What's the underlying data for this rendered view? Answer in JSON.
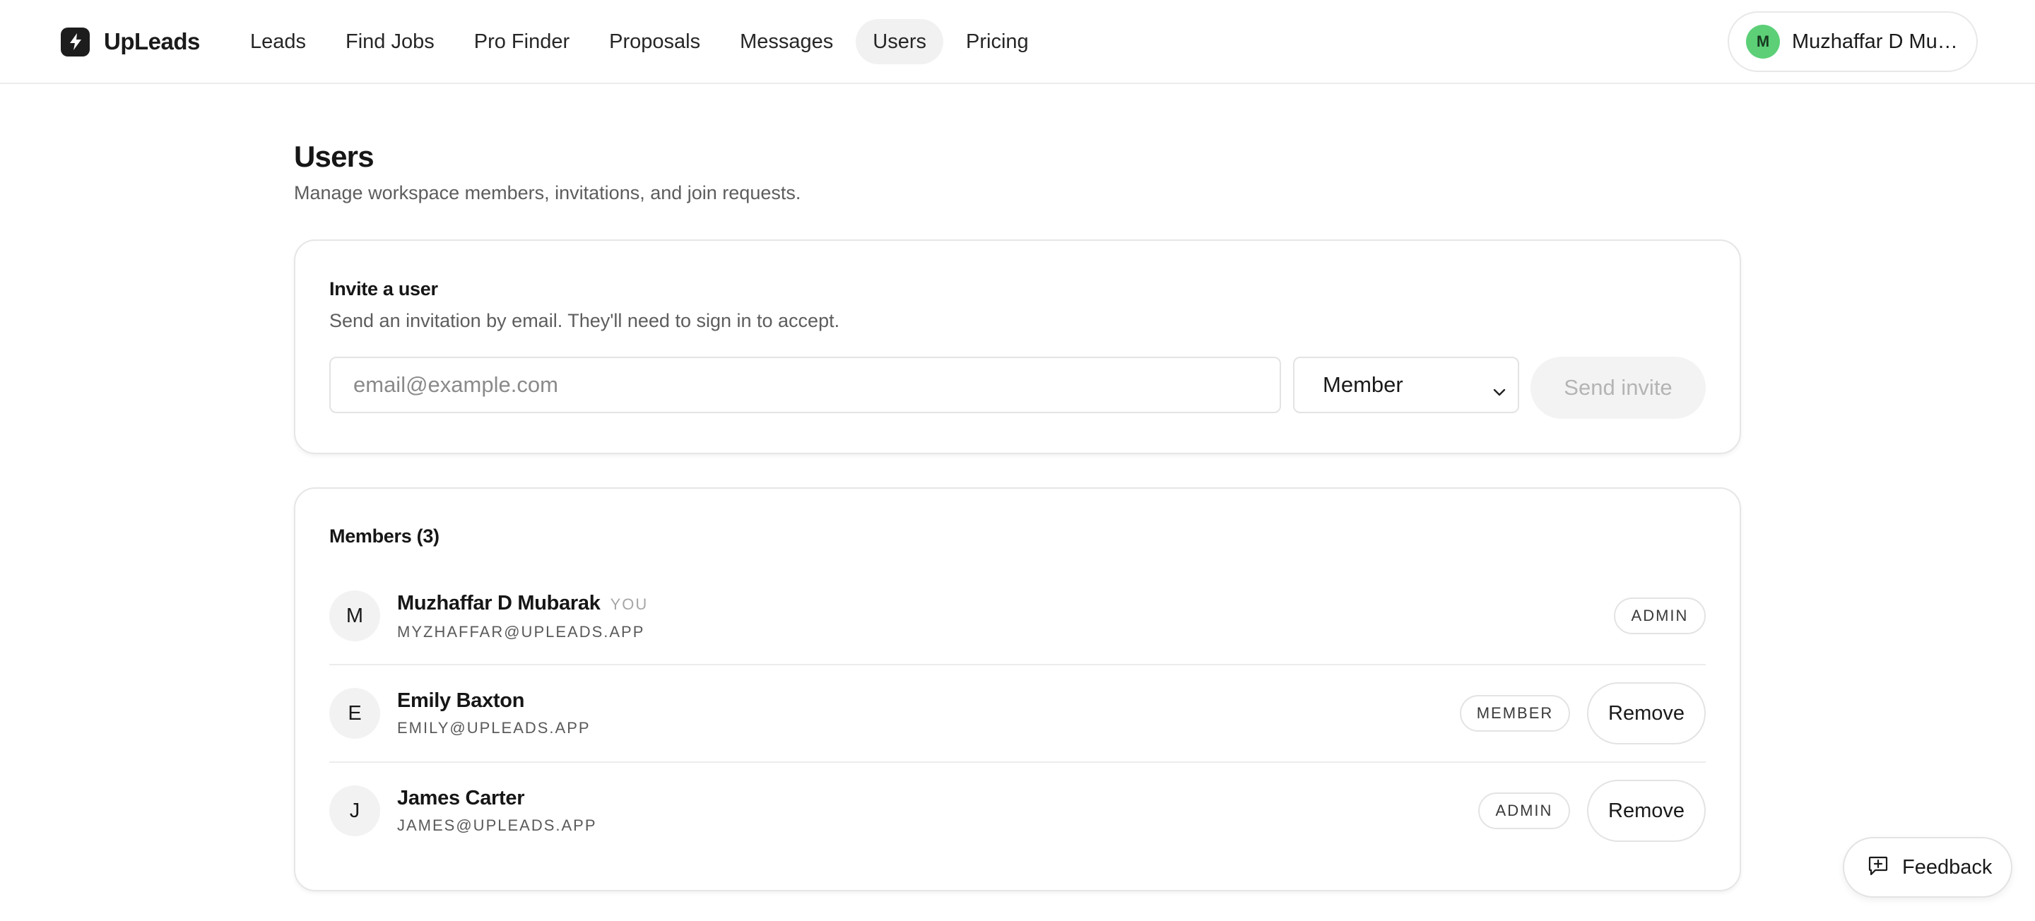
{
  "header": {
    "brand_name": "UpLeads",
    "brand_icon": "bolt-icon",
    "nav": [
      {
        "label": "Leads",
        "active": false
      },
      {
        "label": "Find Jobs",
        "active": false
      },
      {
        "label": "Pro Finder",
        "active": false
      },
      {
        "label": "Proposals",
        "active": false
      },
      {
        "label": "Messages",
        "active": false
      },
      {
        "label": "Users",
        "active": true
      },
      {
        "label": "Pricing",
        "active": false
      }
    ],
    "account": {
      "initial": "M",
      "name": "Muzhaffar D Mubarak",
      "avatar_color": "#5ccf77"
    }
  },
  "page": {
    "title": "Users",
    "subtitle": "Manage workspace members, invitations, and join requests."
  },
  "invite": {
    "title": "Invite a user",
    "description": "Send an invitation by email. They'll need to sign in to accept.",
    "email_placeholder": "email@example.com",
    "email_value": "",
    "role_selected": "Member",
    "send_label": "Send invite"
  },
  "members": {
    "title": "Members (3)",
    "rows": [
      {
        "initial": "M",
        "name": "Muzhaffar D Mubarak",
        "you_tag": "YOU",
        "email": "MYZHAFFAR@UPLEADS.APP",
        "role": "ADMIN",
        "remove_label": ""
      },
      {
        "initial": "E",
        "name": "Emily Baxton",
        "you_tag": "",
        "email": "EMILY@UPLEADS.APP",
        "role": "MEMBER",
        "remove_label": "Remove"
      },
      {
        "initial": "J",
        "name": "James Carter",
        "you_tag": "",
        "email": "JAMES@UPLEADS.APP",
        "role": "ADMIN",
        "remove_label": "Remove"
      }
    ]
  },
  "feedback": {
    "label": "Feedback",
    "icon": "message-plus-icon"
  },
  "colors": {
    "accent_green": "#5ccf77",
    "text_primary": "#1a1a1a",
    "text_muted": "#5d5d5d",
    "border": "#e6e6e6"
  }
}
